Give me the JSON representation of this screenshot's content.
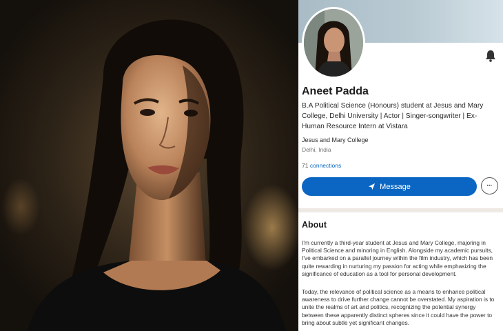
{
  "profile": {
    "name": "Aneet Padda",
    "headline": "B.A Political Science (Honours) student at Jesus and Mary College, Delhi University | Actor | Singer-songwriter | Ex-Human Resource Intern at Vistara",
    "school": "Jesus and Mary College",
    "location": "Delhi, India",
    "connections_count": "71",
    "connections_label": "connections",
    "message_label": "Message",
    "more_label": "•••"
  },
  "about": {
    "title": "About",
    "paragraph1": "I'm currently a third-year student at Jesus and Mary College, majoring in Political Science and minoring in English. Alongside my academic pursuits, I've embarked on a parallel journey within the film industry, which has been quite rewarding in nurturing my passion for acting while emphasizing the significance of education as a tool for personal development.",
    "paragraph2": "Today, the relevance of political science as a means to enhance political awareness to drive further change cannot be overstated. My aspiration is to unite the realms of art and politics, recognizing the potential synergy between these apparently distinct spheres since it could have the power to bring about subtle yet significant changes."
  },
  "icons": {
    "bell": "bell-icon",
    "send": "send-icon",
    "more": "more-icon"
  },
  "colors": {
    "accent": "#0a66c2",
    "divider": "#eee9e3"
  }
}
